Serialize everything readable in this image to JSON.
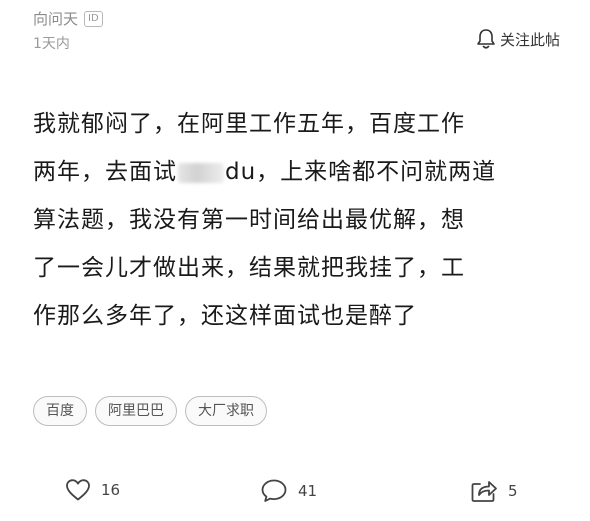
{
  "author": {
    "name": "向问天",
    "badge": "ID",
    "time": "1天内"
  },
  "follow": {
    "label": "关注此帖",
    "icon": "bell-icon"
  },
  "post": {
    "lines": [
      "我就郁闷了，在阿里工作五年，百度工作",
      "两年，去面试",
      "du，上来啥都不问就两道",
      "算法题，我没有第一时间给出最优解，想",
      "了一会儿才做出来，结果就把我挂了，工",
      "作那么多年了，还这样面试也是醉了"
    ]
  },
  "tags": [
    "百度",
    "阿里巴巴",
    "大厂求职"
  ],
  "actions": {
    "likes": "16",
    "comments": "41",
    "shares": "5"
  }
}
